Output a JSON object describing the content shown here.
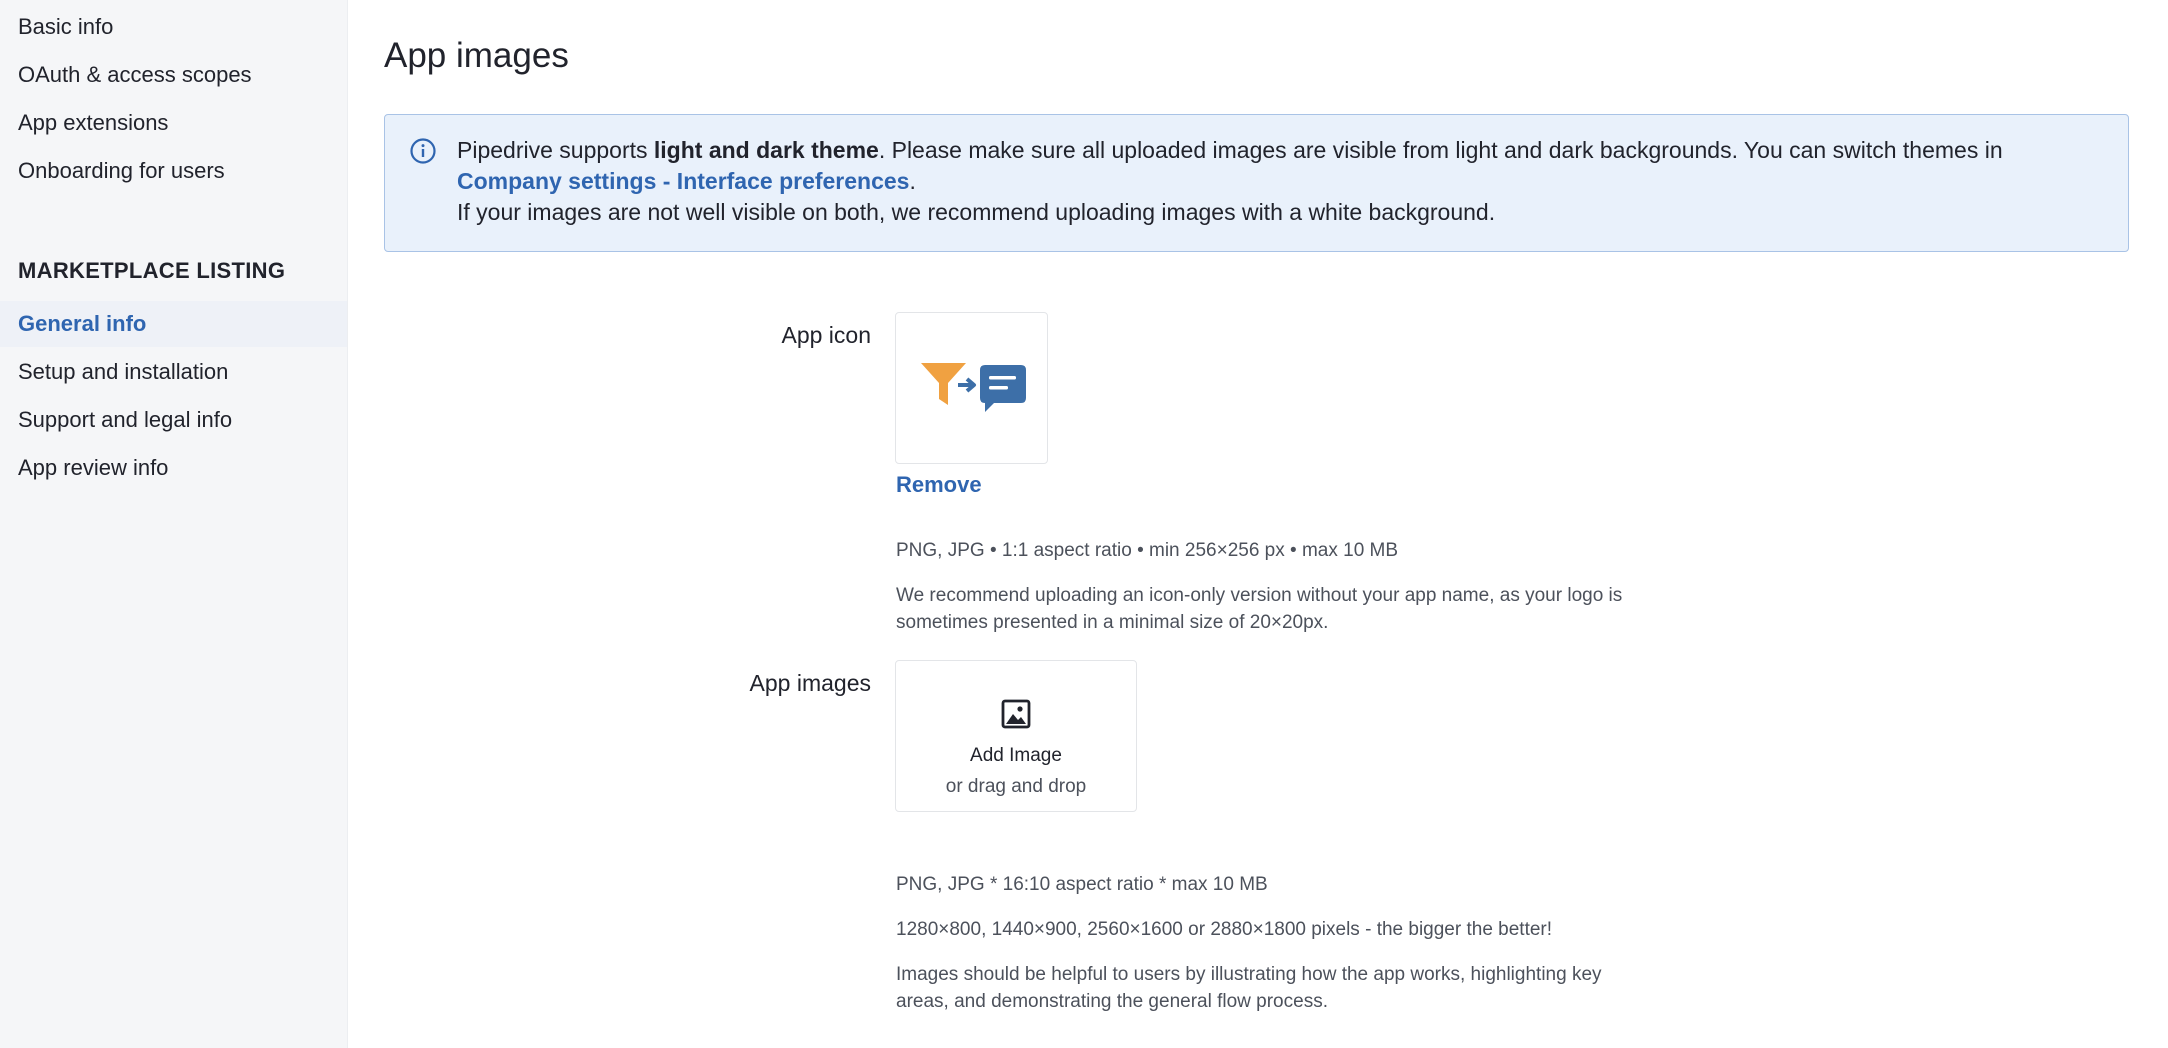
{
  "sidebar": {
    "top_items": [
      {
        "label": "Basic info"
      },
      {
        "label": "OAuth & access scopes"
      },
      {
        "label": "App extensions"
      },
      {
        "label": "Onboarding for users"
      }
    ],
    "section_heading": "MARKETPLACE LISTING",
    "listing_items": [
      {
        "label": "General info",
        "active": true
      },
      {
        "label": "Setup and installation"
      },
      {
        "label": "Support and legal info"
      },
      {
        "label": "App review info"
      }
    ]
  },
  "main": {
    "title": "App images",
    "banner": {
      "icon": "info-icon",
      "text_before": "Pipedrive supports ",
      "text_bold": "light and dark theme",
      "text_middle": ". Please make sure all uploaded images are visible from light and dark backgrounds. You can switch themes in ",
      "link": "Company settings - Interface preferences",
      "text_after": ".",
      "line2": "If your images are not well visible on both, we recommend uploading images with a white background."
    },
    "app_icon": {
      "label": "App icon",
      "image_icon": "funnel-chat-logo-icon",
      "remove_label": "Remove",
      "hint_format": "PNG, JPG • 1:1 aspect ratio • min 256×256 px • max 10 MB",
      "hint_recommend": "We recommend uploading an icon-only version without your app name, as your logo is sometimes presented in a minimal size of 20×20px."
    },
    "app_images": {
      "label": "App images",
      "add_icon": "image-icon",
      "add_title": "Add Image",
      "add_sub": "or drag and drop",
      "hint_format": "PNG, JPG * 16:10 aspect ratio * max 10 MB",
      "hint_sizes": "1280×800, 1440×900, 2560×1600 or 2880×1800 pixels - the bigger the better!",
      "hint_helpful": "Images should be helpful to users by illustrating how the app works, highlighting key areas, and demonstrating the general flow process."
    }
  },
  "colors": {
    "accent": "#2f65b0",
    "sidebar_bg": "#f5f6f8",
    "banner_bg": "#e9f1fb",
    "banner_border": "#a9c3e6",
    "logo_orange": "#f0a141",
    "logo_blue": "#3d6fa8"
  }
}
